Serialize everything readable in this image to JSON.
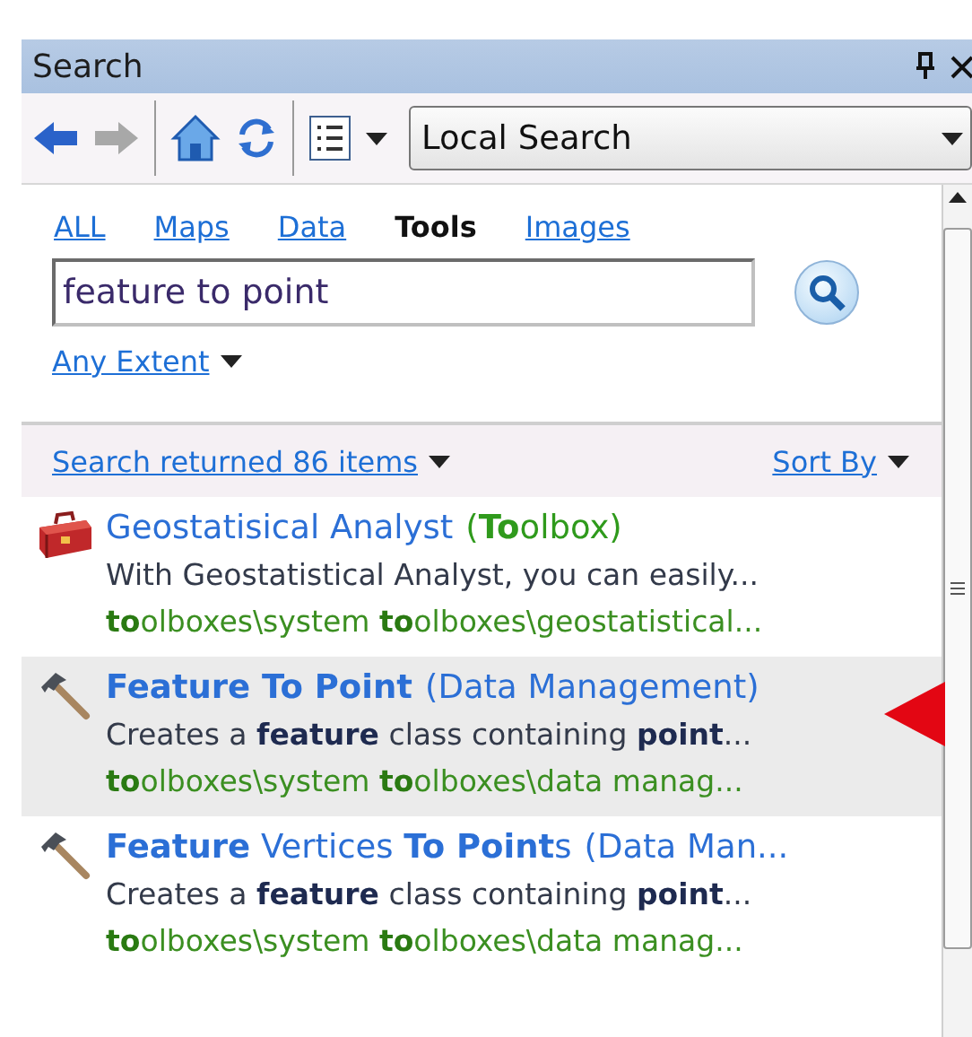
{
  "window": {
    "title": "Search"
  },
  "toolbar": {
    "scope": "Local Search"
  },
  "tabs": [
    {
      "label": "ALL",
      "selected": false
    },
    {
      "label": "Maps",
      "selected": false
    },
    {
      "label": "Data",
      "selected": false
    },
    {
      "label": "Tools",
      "selected": true
    },
    {
      "label": "Images",
      "selected": false
    }
  ],
  "search": {
    "value": "feature to point"
  },
  "extent": "Any Extent",
  "results_header": {
    "summary": "Search returned 86 items",
    "sort": "Sort By"
  },
  "results": [
    {
      "kind": "toolbox",
      "title": "Geostatisical Analyst",
      "category": "(**To**olbox)",
      "description": "With Geostatistical Analyst, you can easily...",
      "path": "**to**olboxes\\system **to**olboxes\\geostatistical...",
      "selected": false,
      "pointer": false
    },
    {
      "kind": "tool",
      "title": "**Feature To Point**",
      "category": "(Data Management)",
      "description": "Creates a **feature** class containing **point**...",
      "path": "**to**olboxes\\system **to**olboxes\\data manag...",
      "selected": true,
      "pointer": true
    },
    {
      "kind": "tool",
      "title": "**Feature** Vertices **To Point**s",
      "category": "(Data Man...",
      "description": "Creates a **feature** class containing **point**...",
      "path": "**to**olboxes\\system **to**olboxes\\data manag...",
      "selected": false,
      "pointer": false
    }
  ]
}
